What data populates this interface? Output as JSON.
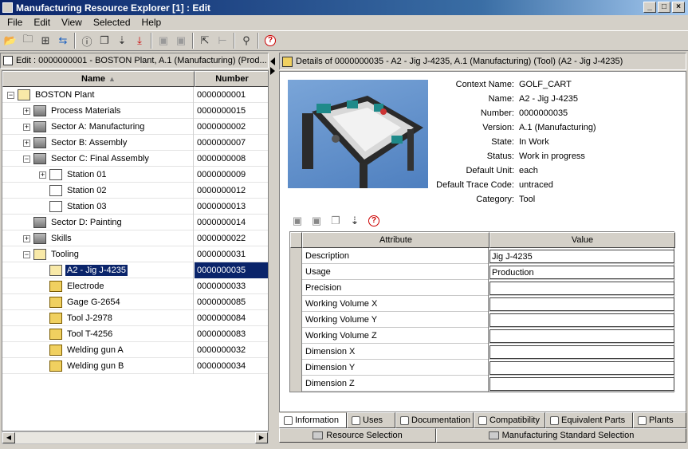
{
  "window": {
    "title": "Manufacturing Resource Explorer [1] : Edit"
  },
  "menu": [
    "File",
    "Edit",
    "View",
    "Selected",
    "Help"
  ],
  "left": {
    "header": "Edit : 0000000001 - BOSTON Plant, A.1 (Manufacturing) (Prod...",
    "col_name": "Name",
    "col_number": "Number",
    "rows": [
      {
        "name": "BOSTON Plant",
        "number": "0000000001"
      },
      {
        "name": "Process Materials",
        "number": "0000000015"
      },
      {
        "name": "Sector A: Manufacturing",
        "number": "0000000002"
      },
      {
        "name": "Sector B: Assembly",
        "number": "0000000007"
      },
      {
        "name": "Sector C: Final Assembly",
        "number": "0000000008"
      },
      {
        "name": "Station 01",
        "number": "0000000009"
      },
      {
        "name": "Station 02",
        "number": "0000000012"
      },
      {
        "name": "Station 03",
        "number": "0000000013"
      },
      {
        "name": "Sector D: Painting",
        "number": "0000000014"
      },
      {
        "name": "Skills",
        "number": "0000000022"
      },
      {
        "name": "Tooling",
        "number": "0000000031"
      },
      {
        "name": "A2 - Jig J-4235",
        "number": "0000000035"
      },
      {
        "name": "Electrode",
        "number": "0000000033"
      },
      {
        "name": "Gage G-2654",
        "number": "0000000085"
      },
      {
        "name": "Tool J-2978",
        "number": "0000000084"
      },
      {
        "name": "Tool T-4256",
        "number": "0000000083"
      },
      {
        "name": "Welding gun A",
        "number": "0000000032"
      },
      {
        "name": "Welding gun B",
        "number": "0000000034"
      }
    ]
  },
  "right": {
    "header": "Details of 0000000035 - A2 - Jig J-4235, A.1 (Manufacturing) (Tool) (A2 - Jig J-4235)",
    "props": [
      {
        "k": "Context Name:",
        "v": "GOLF_CART"
      },
      {
        "k": "Name:",
        "v": "A2 - Jig J-4235"
      },
      {
        "k": "Number:",
        "v": "0000000035"
      },
      {
        "k": "Version:",
        "v": "A.1 (Manufacturing)"
      },
      {
        "k": "State:",
        "v": "In Work"
      },
      {
        "k": "Status:",
        "v": "Work in progress"
      },
      {
        "k": "Default Unit:",
        "v": "each"
      },
      {
        "k": "Default Trace Code:",
        "v": "untraced"
      },
      {
        "k": "Category:",
        "v": "Tool"
      }
    ],
    "grid": {
      "col_attr": "Attribute",
      "col_value": "Value",
      "rows": [
        {
          "a": "Description",
          "v": "Jig J-4235"
        },
        {
          "a": "Usage",
          "v": "Production"
        },
        {
          "a": "Precision",
          "v": ""
        },
        {
          "a": "Working Volume X",
          "v": ""
        },
        {
          "a": "Working Volume Y",
          "v": ""
        },
        {
          "a": "Working Volume Z",
          "v": ""
        },
        {
          "a": "Dimension X",
          "v": ""
        },
        {
          "a": "Dimension Y",
          "v": ""
        },
        {
          "a": "Dimension Z",
          "v": ""
        }
      ]
    },
    "tabs": [
      "Information",
      "Uses",
      "Documentation",
      "Compatibility",
      "Equivalent Parts",
      "Plants"
    ],
    "bottom_tabs": [
      "Resource Selection",
      "Manufacturing Standard Selection"
    ]
  }
}
